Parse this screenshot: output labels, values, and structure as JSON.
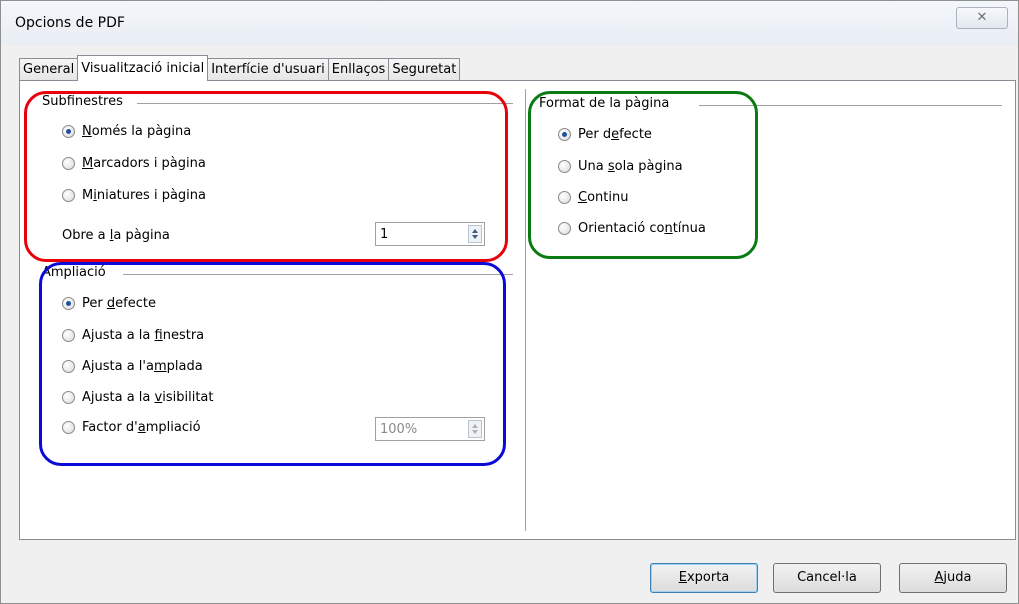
{
  "window": {
    "title": "Opcions de PDF",
    "close_glyph": "✕"
  },
  "tabs": [
    {
      "label": "General"
    },
    {
      "label": "Visualització inicial"
    },
    {
      "label": "Interfície d'usuari"
    },
    {
      "label": "Enllaços"
    },
    {
      "label": "Seguretat"
    }
  ],
  "active_tab": "Visualització inicial",
  "panes": {
    "title": "Subfinestres",
    "options": [
      {
        "pre": "",
        "u": "N",
        "post": "omés la pàgina",
        "full": "Només la pàgina",
        "checked": true
      },
      {
        "pre": "",
        "u": "M",
        "post": "arcadors i pàgina",
        "full": "Marcadors i pàgina",
        "checked": false
      },
      {
        "pre": "M",
        "u": "i",
        "post": "niatures i pàgina",
        "full": "Miniatures i pàgina",
        "checked": false
      }
    ],
    "open_page_label_pre": "Obre a ",
    "open_page_label_u": "l",
    "open_page_label_post": "a pàgina",
    "open_page_value": "1"
  },
  "magnification": {
    "title": "Ampliació",
    "options": [
      {
        "pre": "Per ",
        "u": "d",
        "post": "efecte",
        "checked": true
      },
      {
        "pre": "Ajusta a la ",
        "u": "f",
        "post": "inestra",
        "checked": false
      },
      {
        "pre": "Ajusta a l'a",
        "u": "m",
        "post": "plada",
        "checked": false
      },
      {
        "pre": "Ajusta a la ",
        "u": "v",
        "post": "isibilitat",
        "checked": false
      },
      {
        "pre": "Factor d'",
        "u": "a",
        "post": "mpliació",
        "checked": false
      }
    ],
    "zoom_value": "100%"
  },
  "page_layout": {
    "title": "Format de la pàgina",
    "options": [
      {
        "pre": "Per d",
        "u": "e",
        "post": "fecte",
        "checked": true
      },
      {
        "pre": "Una ",
        "u": "s",
        "post": "ola pàgina",
        "checked": false
      },
      {
        "pre": "",
        "u": "C",
        "post": "ontinu",
        "checked": false
      },
      {
        "pre": "Orientació co",
        "u": "n",
        "post": "tínua",
        "checked": false
      }
    ]
  },
  "buttons": {
    "export": {
      "pre": "",
      "u": "E",
      "post": "xporta"
    },
    "cancel": {
      "pre": "Cancel·la",
      "u": "",
      "post": ""
    },
    "help": {
      "pre": "",
      "u": "A",
      "post": "juda"
    }
  },
  "colors": {
    "highlight_panes": "#e8000b",
    "highlight_magnification": "#0a0bd6",
    "highlight_layout": "#0a7a12"
  }
}
